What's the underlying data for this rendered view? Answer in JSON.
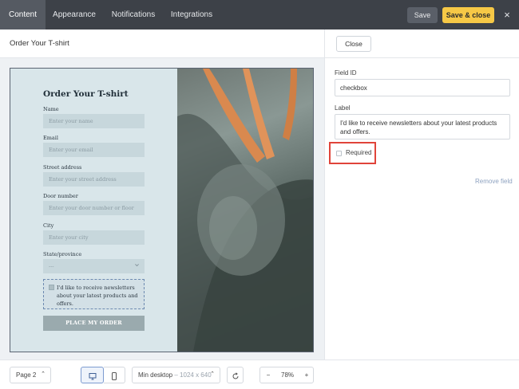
{
  "topbar": {
    "tabs": [
      {
        "label": "Content",
        "active": true
      },
      {
        "label": "Appearance",
        "active": false
      },
      {
        "label": "Notifications",
        "active": false
      },
      {
        "label": "Integrations",
        "active": false
      }
    ],
    "save_label": "Save",
    "save_close_label": "Save & close",
    "close_icon": "×"
  },
  "canvas": {
    "page_title": "Order Your T-shirt"
  },
  "form": {
    "title": "Order Your T-shirt",
    "fields": [
      {
        "label": "Name",
        "placeholder": "Enter your name"
      },
      {
        "label": "Email",
        "placeholder": "Enter your email"
      },
      {
        "label": "Street address",
        "placeholder": "Enter your street address"
      },
      {
        "label": "Door number",
        "placeholder": "Enter your door number or floor"
      },
      {
        "label": "City",
        "placeholder": "Enter your city"
      }
    ],
    "state": {
      "label": "State/province",
      "value": "---"
    },
    "checkbox_text": "I'd like to receive newsletters about your latest products and offers.",
    "submit_label": "PLACE MY ORDER"
  },
  "panel": {
    "close_label": "Close",
    "field_id_label": "Field ID",
    "field_id_value": "checkbox",
    "label_label": "Label",
    "label_value": "I'd like to receive newsletters about your latest products and offers.",
    "required_label": "Required",
    "remove_field_label": "Remove field"
  },
  "bottombar": {
    "page_label": "Page 2",
    "viewport_label": "Min desktop",
    "viewport_size": "– 1024 x 640",
    "zoom": "78%",
    "minus": "−",
    "plus": "+"
  },
  "icons": {
    "chevron": "⌃",
    "desktop": "desktop-icon",
    "mobile": "mobile-icon",
    "rotate": "rotate-icon"
  }
}
